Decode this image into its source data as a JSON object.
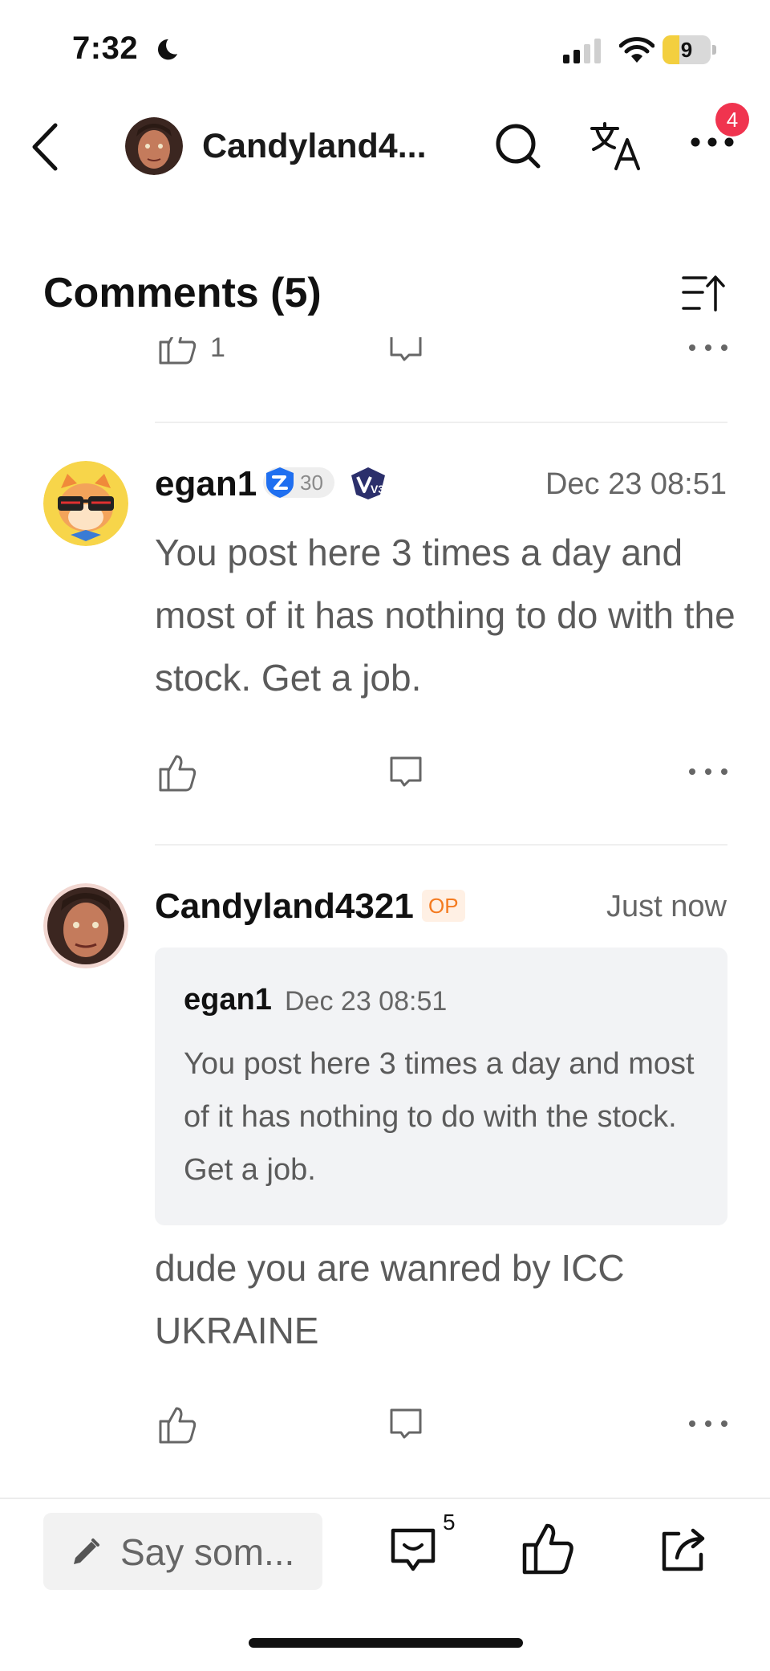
{
  "status_bar": {
    "time": "7:32",
    "battery_level": "9",
    "battery_fraction": 0.09
  },
  "nav": {
    "title": "Candyland4...",
    "notification_count": "4"
  },
  "comments": {
    "heading": "Comments (5)"
  },
  "partial_row": {
    "like_count": "1"
  },
  "comment_egan": {
    "username": "egan1",
    "level": "30",
    "vip_badge": "V3",
    "timestamp": "Dec 23 08:51",
    "text": "You post here 3 times a day and most of it has nothing to do with the stock. Get a job."
  },
  "comment_op": {
    "username": "Candyland4321",
    "op_tag": "OP",
    "timestamp": "Just now",
    "quote": {
      "username": "egan1",
      "timestamp": "Dec 23 08:51",
      "text": "You post here 3 times a day and most of it has nothing to do with the stock. Get a job."
    },
    "text": "dude you are wanred by ICC UKRAINE"
  },
  "bottom_bar": {
    "placeholder": "Say som...",
    "comment_count": "5"
  },
  "colors": {
    "accent_red": "#f0344f",
    "op_orange": "#f47b20",
    "verify_blue": "#1f6ff0"
  },
  "icons": [
    "back-icon",
    "search-icon",
    "translate-icon",
    "more-icon",
    "sort-icon",
    "like-icon",
    "reply-icon",
    "pencil-icon",
    "comment-icon",
    "share-icon"
  ]
}
